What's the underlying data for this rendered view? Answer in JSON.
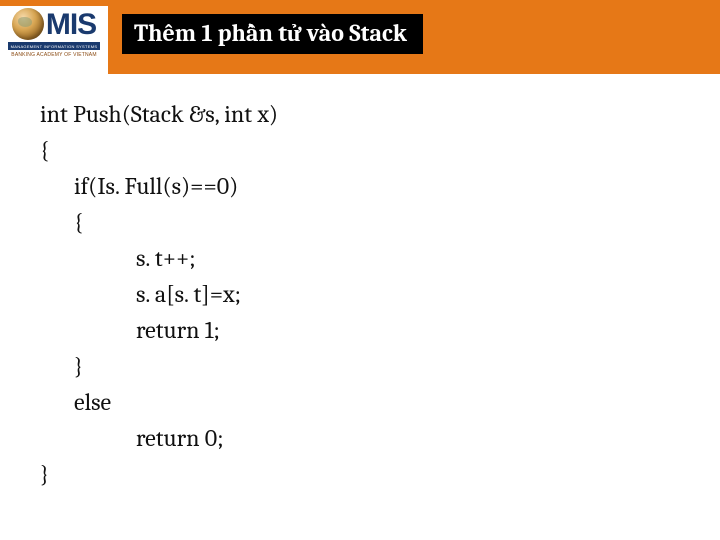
{
  "logo": {
    "text": "MIS",
    "bar_text": "MANAGEMENT INFORMATION SYSTEMS",
    "subtext": "BANKING ACADEMY OF VIETNAM"
  },
  "title": "Thêm 1 phần tử vào Stack",
  "code": {
    "l1": "int Push(Stack &s, int x)",
    "l2": "{",
    "l3": "if(Is. Full(s)==0)",
    "l4": "{",
    "l5": "s. t++;",
    "l6": "s. a[s. t]=x;",
    "l7": "return 1;",
    "l8": "}",
    "l9": "else",
    "l10": "return 0;",
    "l11": "}"
  }
}
